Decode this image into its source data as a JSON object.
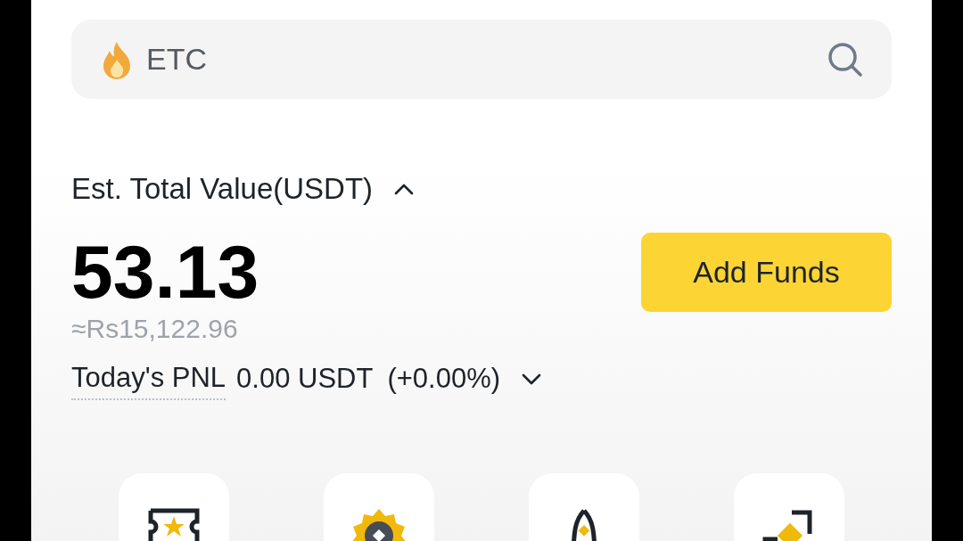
{
  "search": {
    "placeholder": "ETC"
  },
  "balance": {
    "label": "Est. Total Value(USDT)",
    "expanded": true,
    "value": "53.13",
    "fiat": "≈Rs15,122.96",
    "add_funds": "Add Funds"
  },
  "pnl": {
    "label": "Today's PNL",
    "value": "0.00 USDT",
    "change": "(+0.00%)",
    "expanded": false
  },
  "shortcuts": [
    {
      "kind": "ticket"
    },
    {
      "kind": "coin"
    },
    {
      "kind": "rocket"
    },
    {
      "kind": "transfer"
    }
  ]
}
